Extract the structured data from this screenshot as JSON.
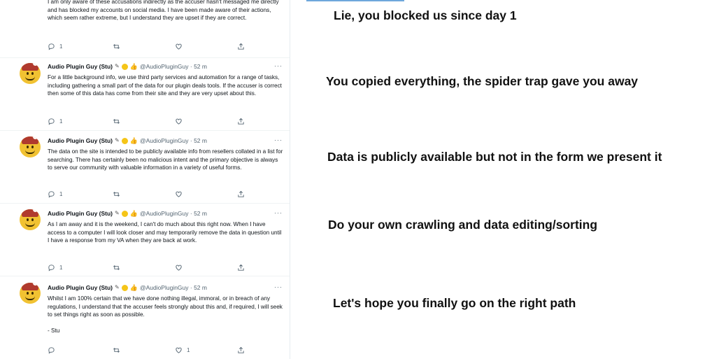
{
  "tweets": [
    {
      "name": "",
      "handle": "",
      "time": "",
      "text": "I am only aware of these accusations indirectly as the accuser hasn't messaged me directly and has blocked my accounts on social media. I have been made aware of their actions, which seem rather extreme, but I understand they are upset if they are correct.",
      "replies": "1",
      "retweets": "",
      "likes": ""
    },
    {
      "name": "Audio Plugin Guy (Stu)",
      "handle": "@AudioPluginGuy · 52 m",
      "time": "52 m",
      "text": "For a little background info, we use third party services and automation for a range of tasks, including gathering a small part of the data for our plugin deals tools. If the accuser is correct then some of this data has come from their site and they are very upset about this.",
      "replies": "1",
      "retweets": "",
      "likes": ""
    },
    {
      "name": "Audio Plugin Guy (Stu)",
      "handle": "@AudioPluginGuy · 52 m",
      "time": "52 m",
      "text": "The data on the site is intended to be publicly available info from resellers collated in a list for searching. There has certainly been no malicious intent and the primary objective is always to serve our community with valuable information in a variety of useful forms.",
      "replies": "1",
      "retweets": "",
      "likes": ""
    },
    {
      "name": "Audio Plugin Guy (Stu)",
      "handle": "@AudioPluginGuy · 52 m",
      "time": "52 m",
      "text": "As I am away and it is the weekend, I can't do much about this right now. When I have access to a computer I will look closer and may temporarily remove the data in question until I have a response from my VA when they are back at work.",
      "replies": "1",
      "retweets": "",
      "likes": ""
    },
    {
      "name": "Audio Plugin Guy (Stu)",
      "handle": "@AudioPluginGuy · 52 m",
      "time": "52 m",
      "text": "Whilst I am 100% certain that we have done nothing illegal, immoral, or in breach of any regulations, I understand that the accuser feels strongly about this and, if required, I will seek to set things right as soon as possible.\n\n- Stu",
      "replies": "",
      "retweets": "",
      "likes": "1"
    }
  ],
  "more_label": "···",
  "annotations": [
    "Lie, you blocked us since day 1",
    "You copied everything, the spider trap gave you away",
    "Data is publicly available but not in the form we present it",
    "Do your own crawling and data editing/sorting",
    "Let's hope you finally go on the right path"
  ],
  "colors": {
    "text": "#0f1419",
    "secondary": "#536471",
    "accent": "#1d9bf0"
  },
  "icons": [
    "reply-icon",
    "retweet-icon",
    "like-icon",
    "share-icon",
    "avatar-santa-hat"
  ]
}
